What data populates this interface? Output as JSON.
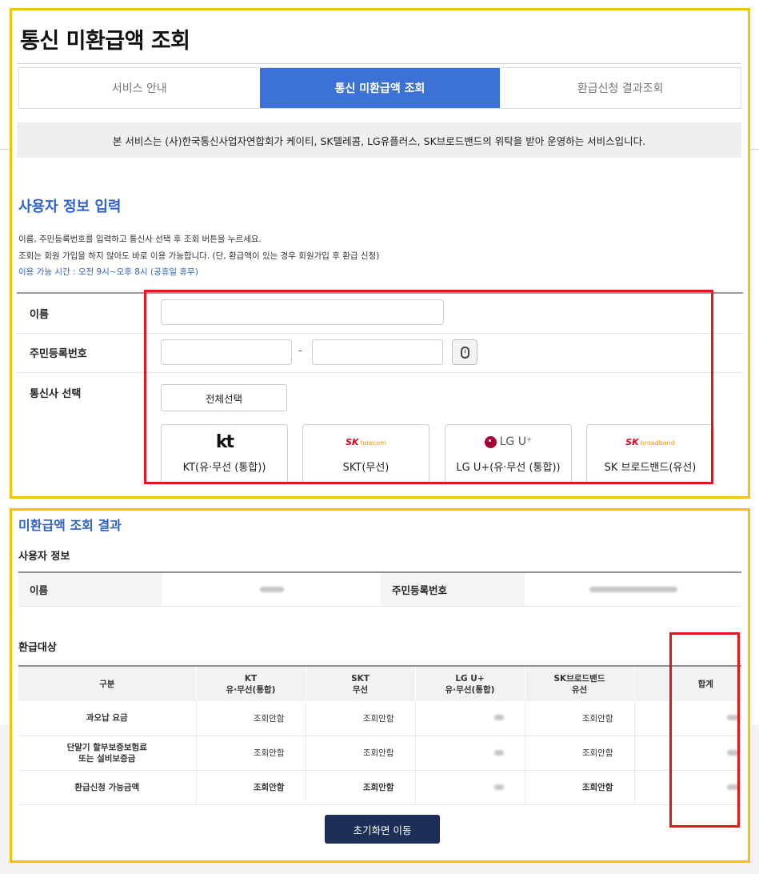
{
  "header": {
    "title": "통신 미환급액 조회"
  },
  "tabs": [
    {
      "label": "서비스 안내",
      "active": false
    },
    {
      "label": "통신 미환급액 조회",
      "active": true
    },
    {
      "label": "환급신청 결과조회",
      "active": false
    }
  ],
  "notice": "본 서비스는 (사)한국통신사업자연합회가 케이티, SK텔레콤, LG유플러스, SK브로드밴드의 위탁을 받아 운영하는 서비스입니다.",
  "user_input": {
    "title": "사용자 정보 입력",
    "guide_lines": [
      "이름, 주민등록번호를 입력하고 통신사 선택 후 조회 버튼을 누르세요.",
      "조회는 회원 가입을 하지 않아도 바로 이용 가능합니다. (단, 환급액이 있는 경우 회원가입 후 환급 신청)",
      "이용 가능 시간 : 오전 9시~오후 8시 (공휴일 휴무)"
    ],
    "name_label": "이름",
    "name_value": "",
    "rrn_label": "주민등록번호",
    "rrn_front_value": "",
    "rrn_back_value": "",
    "rrn_separator": "-",
    "carrier_label": "통신사 선택",
    "select_all_label": "전체선택",
    "carriers": [
      {
        "name": "KT(유·무선 (통합))",
        "logo": "kt"
      },
      {
        "name": "SKT(무선)",
        "logo_main": "SK",
        "logo_sub": "telecom"
      },
      {
        "name": "LG U+(유·무선 (통합))",
        "logo": "LG U⁺"
      },
      {
        "name": "SK 브로드밴드(유선)",
        "logo_main": "SK",
        "logo_sub": "broadband"
      }
    ]
  },
  "result": {
    "title": "미환급액 조회 결과",
    "user_info_heading": "사용자 정보",
    "name_label": "이름",
    "rrn_label": "주민등록번호",
    "refund_heading": "환급대상",
    "columns": [
      {
        "line1": "구분",
        "line2": ""
      },
      {
        "line1": "KT",
        "line2": "유·무선(통합)"
      },
      {
        "line1": "SKT",
        "line2": "무선"
      },
      {
        "line1": "LG U+",
        "line2": "유·무선(통합)"
      },
      {
        "line1": "SK브로드밴드",
        "line2": "유선"
      },
      {
        "line1": "",
        "line2": ""
      },
      {
        "line1": "합계",
        "line2": ""
      }
    ],
    "rows": [
      {
        "category_line1": "과오납 요금",
        "category_line2": "",
        "kt": "조회안함",
        "skt": "조회안함",
        "skb": "조회안함"
      },
      {
        "category_line1": "단말기 할부보증보험료",
        "category_line2": "또는 설비보증금",
        "kt": "조회안함",
        "skt": "조회안함",
        "skb": "조회안함"
      },
      {
        "category_line1": "환급신청 가능금액",
        "category_line2": "",
        "kt": "조회안함",
        "skt": "조회안함",
        "skb": "조회안함"
      }
    ],
    "home_button": "초기화면 이동"
  },
  "colors": {
    "frame": "#f4c20d",
    "accent_blue": "#3c72d6",
    "highlight_red": "#e3161b",
    "button_navy": "#1d2f56"
  }
}
